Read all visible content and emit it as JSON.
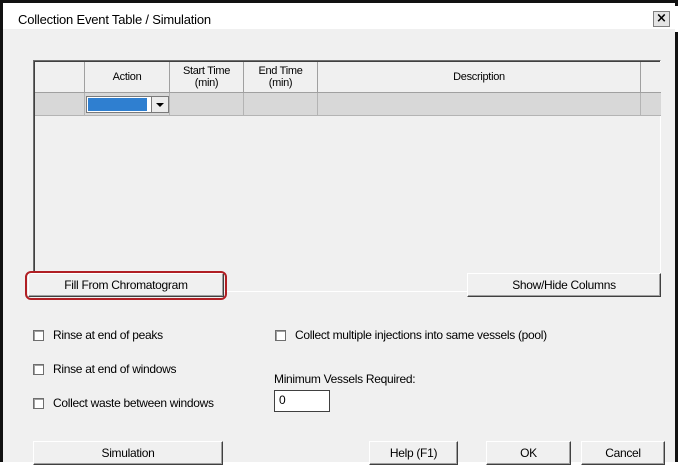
{
  "window": {
    "title": "Collection Event Table / Simulation",
    "close_glyph": "×"
  },
  "table": {
    "columns": [
      {
        "line1": "",
        "line2": ""
      },
      {
        "line1": "Action",
        "line2": ""
      },
      {
        "line1": "Start Time",
        "line2": "(min)"
      },
      {
        "line1": "End Time",
        "line2": "(min)"
      },
      {
        "line1": "Description",
        "line2": ""
      }
    ]
  },
  "buttons": {
    "fill_from_chromatogram": "Fill From Chromatogram",
    "show_hide_columns": "Show/Hide Columns",
    "simulation": "Simulation",
    "help": "Help (F1)",
    "ok": "OK",
    "cancel": "Cancel"
  },
  "options": {
    "rinse_end_peaks": "Rinse at end of peaks",
    "rinse_end_windows": "Rinse at end of windows",
    "collect_waste": "Collect waste between windows",
    "collect_multiple": "Collect multiple injections into same vessels (pool)"
  },
  "min_vessels": {
    "label": "Minimum Vessels Required:",
    "value": "0"
  },
  "colors": {
    "highlight": "#b01f24",
    "selection": "#2f7fd0"
  }
}
